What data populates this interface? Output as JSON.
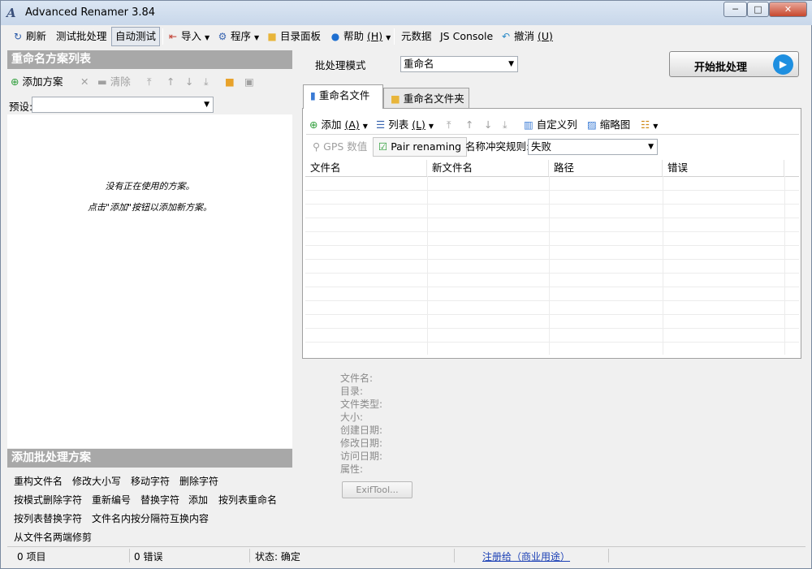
{
  "window": {
    "title": "Advanced Renamer 3.84",
    "minimize": "─",
    "maximize": "□",
    "close": "✕"
  },
  "toolbar": {
    "refresh": "刷新",
    "test_batch": "测试批处理",
    "auto_test": "自动测试",
    "import": "导入",
    "program": "程序",
    "dir_panel": "目录面板",
    "help": "帮助",
    "help_key": "(H)",
    "metadata": "元数据",
    "js_console": "JS Console",
    "undo": "撤消",
    "undo_key": "(U)"
  },
  "left_panel": {
    "header": "重命名方案列表",
    "add_method": "添加方案",
    "clear": "清除",
    "preset_label": "预设:",
    "preset_value": "",
    "empty_line1": "没有正在使用的方案。",
    "empty_line2": "点击\"添加\"按钮以添加新方案。"
  },
  "add_methods": {
    "header": "添加批处理方案",
    "items": [
      "重构文件名",
      "修改大小写",
      "移动字符",
      "删除字符",
      "按模式删除字符",
      "重新编号",
      "替换字符",
      "添加",
      "按列表重命名",
      "按列表替换字符",
      "文件名内按分隔符互换内容",
      "从文件名两端修剪"
    ]
  },
  "batch": {
    "mode_label": "批处理模式",
    "mode_value": "重命名",
    "start_button": "开始批处理"
  },
  "tabs": {
    "files": "重命名文件",
    "folders": "重命名文件夹"
  },
  "files_toolbar": {
    "add": "添加",
    "add_key": "(A)",
    "list": "列表",
    "list_key": "(L)",
    "custom_columns": "自定义列",
    "thumbnails": "缩略图",
    "gps": "GPS 数值",
    "pair_renaming": "Pair renaming",
    "conflict_label": "名称冲突规则:",
    "conflict_value": "失败"
  },
  "grid": {
    "columns": [
      "文件名",
      "新文件名",
      "路径",
      "错误"
    ]
  },
  "info": {
    "labels": [
      "文件名:",
      "目录:",
      "文件类型:",
      "大小:",
      "创建日期:",
      "修改日期:",
      "访问日期:",
      "属性:"
    ],
    "exif_button": "ExifTool..."
  },
  "status": {
    "items": "0 项目",
    "errors": "0 错误",
    "state": "状态: 确定",
    "register": "注册给（商业用途）"
  },
  "colors": {
    "accent": "#1e8fe0",
    "panel_header": "#a8a8a8",
    "link": "#1a3fb5"
  }
}
